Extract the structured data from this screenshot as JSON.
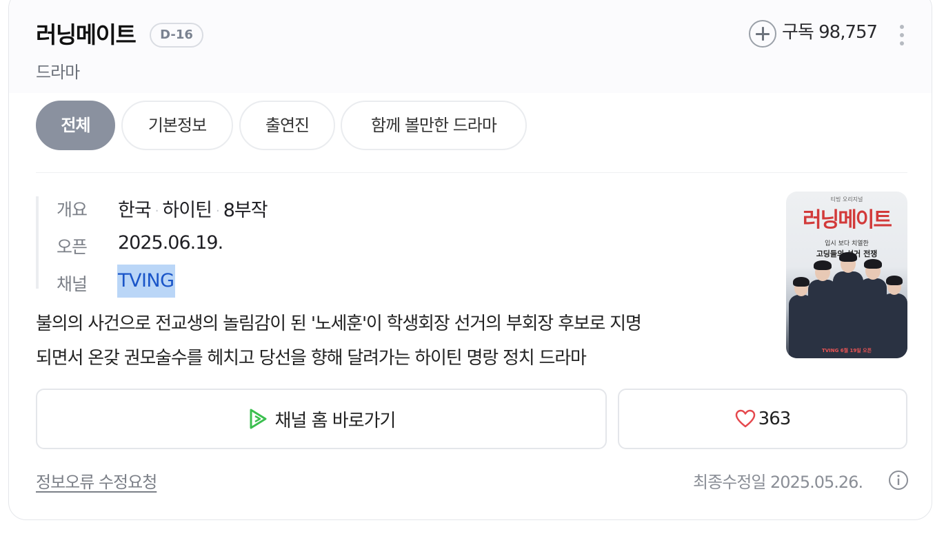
{
  "header": {
    "title": "러닝메이트",
    "dday_badge": "D-16",
    "subtitle": "드라마",
    "subscribe_label": "구독 98,757"
  },
  "tabs": [
    {
      "label": "전체",
      "active": true
    },
    {
      "label": "기본정보",
      "active": false
    },
    {
      "label": "출연진",
      "active": false
    },
    {
      "label": "함께 볼만한 드라마",
      "active": false
    }
  ],
  "info": {
    "overview_label": "개요",
    "overview_country": "한국",
    "overview_genre": "하이틴",
    "overview_episodes": "8부작",
    "open_label": "오픈",
    "open_value": "2025.06.19.",
    "channel_label": "채널",
    "channel_value": "TVING"
  },
  "synopsis": {
    "line1": "불의의 사건으로 전교생의 놀림감이 된 '노세훈'이 학생회장 선거의 부회장 후보로 지명",
    "line2": "되면서 온갖 권모술수를 헤치고 당선을 향해 달려가는 하이틴 명랑 정치 드라마"
  },
  "poster": {
    "top_text": "티빙 오리지널",
    "title": "러닝메이트",
    "tagline1": "입시 보다 치열한",
    "tagline2": "고딩들의 선거 전쟁",
    "bottom_text": "TVING 6월 19일 오픈"
  },
  "actions": {
    "channel_home_label": "채널 홈 바로가기",
    "like_count": "363"
  },
  "footer": {
    "report_label": "정보오류 수정요청",
    "updated_label": "최종수정일 2025.05.26."
  },
  "colors": {
    "active_tab": "#8a919f",
    "link_highlight": "#bad6f7",
    "link_text": "#1a55c8",
    "play_icon": "#3bbf4f",
    "heart_icon": "#e5484d"
  }
}
